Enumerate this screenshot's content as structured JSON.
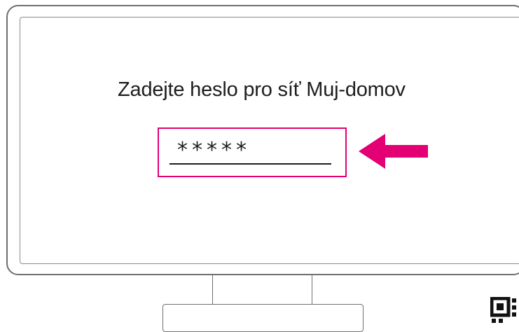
{
  "dialog": {
    "prompt": "Zadejte heslo pro síť Muj-domov",
    "password_value": "*****"
  },
  "colors": {
    "accent": "#e20074",
    "text": "#1d1d1d",
    "outline": "#6f6f6f"
  },
  "icons": {
    "pointer": "arrow-left-icon",
    "corner": "qr-code-icon"
  }
}
